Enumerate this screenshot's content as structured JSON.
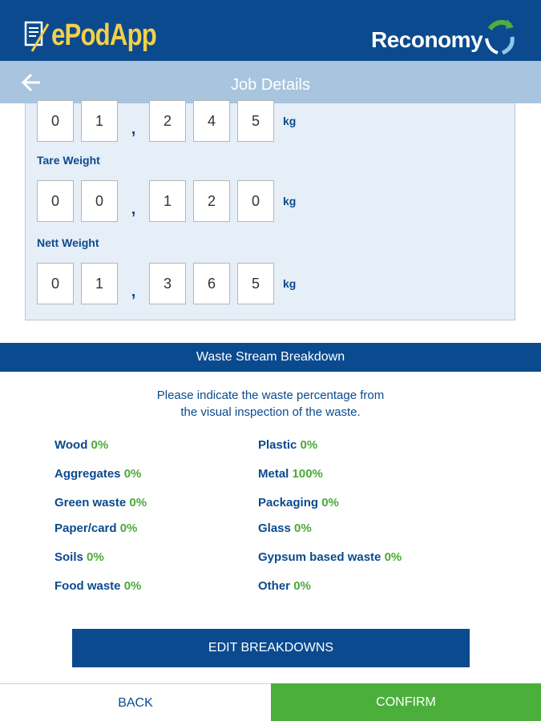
{
  "header": {
    "app_logo_text": "ePodApp",
    "brand_logo_text": "Reconomy",
    "colors": {
      "primary": "#0b4a8f",
      "accent_yellow": "#f2d04a",
      "green": "#4caf3c"
    }
  },
  "titlebar": {
    "title": "Job Details",
    "back_icon": "arrow-left-icon"
  },
  "weights": {
    "gross": {
      "digits": [
        "0",
        "1",
        "2",
        "4",
        "5"
      ],
      "unit": "kg"
    },
    "tare": {
      "label": "Tare Weight",
      "digits": [
        "0",
        "0",
        "1",
        "2",
        "0"
      ],
      "unit": "kg"
    },
    "nett": {
      "label": "Nett Weight",
      "digits": [
        "0",
        "1",
        "3",
        "6",
        "5"
      ],
      "unit": "kg"
    },
    "separator": ","
  },
  "waste_stream": {
    "header": "Waste Stream Breakdown",
    "instruction_line1": "Please indicate the waste percentage from",
    "instruction_line2": "the visual inspection of the waste.",
    "items": [
      {
        "label": "Wood",
        "value": "0%"
      },
      {
        "label": "Plastic",
        "value": "0%"
      },
      {
        "label": "Aggregates",
        "value": "0%"
      },
      {
        "label": "Metal",
        "value": "100%"
      },
      {
        "label": "Green waste",
        "value": "0%"
      },
      {
        "label": "Packaging",
        "value": "0%"
      },
      {
        "label": "Paper/card",
        "value": "0%"
      },
      {
        "label": "Glass",
        "value": "0%"
      },
      {
        "label": "Soils",
        "value": "0%"
      },
      {
        "label": "Gypsum based waste",
        "value": "0%"
      },
      {
        "label": "Food waste",
        "value": "0%"
      },
      {
        "label": "Other",
        "value": "0%"
      }
    ],
    "edit_button": "EDIT BREAKDOWNS"
  },
  "footer": {
    "back_label": "BACK",
    "confirm_label": "CONFIRM"
  }
}
